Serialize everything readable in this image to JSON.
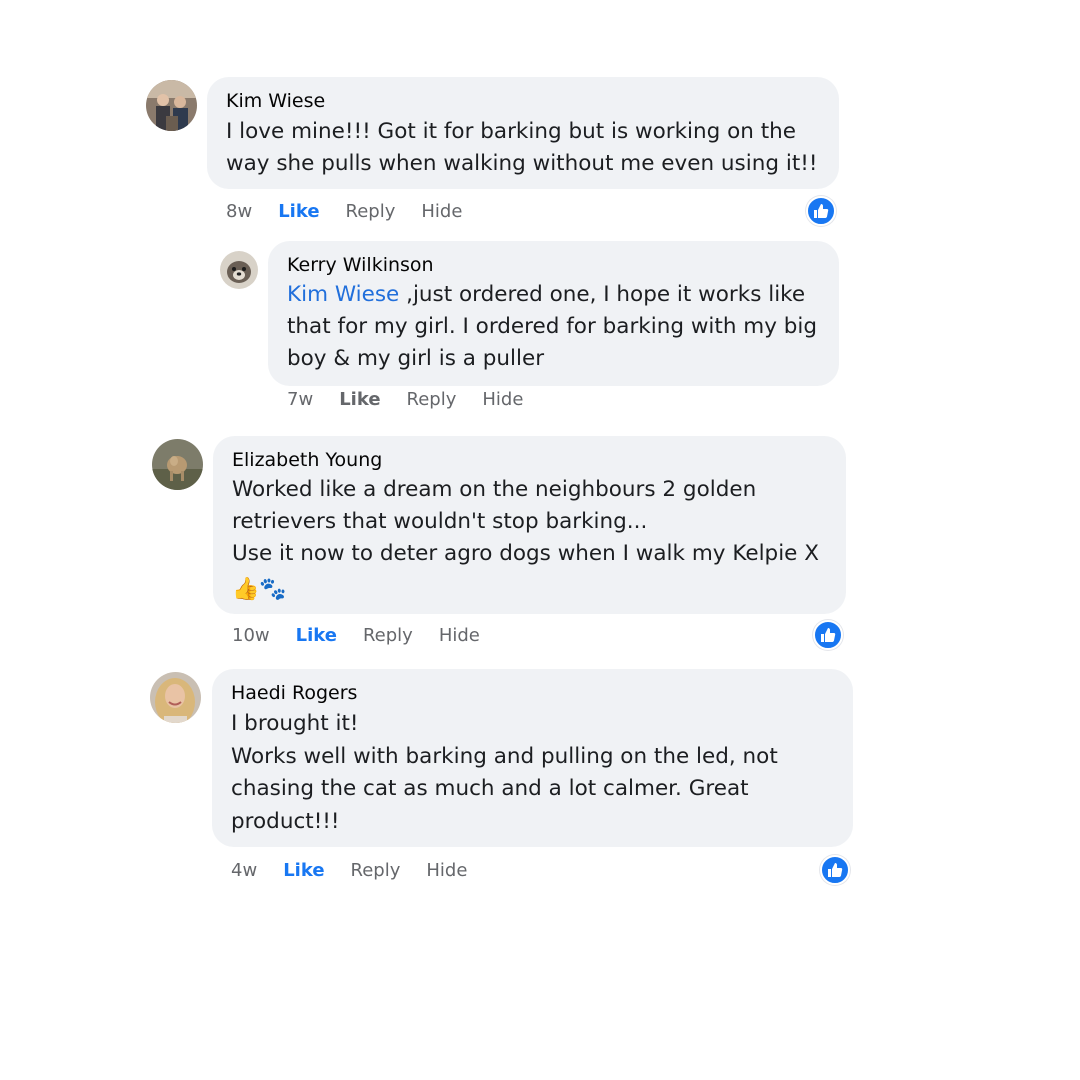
{
  "comments": [
    {
      "author": "Kim Wiese",
      "lines": [
        "I love mine!!! Got it for barking but is working on the",
        "way she pulls when walking without me even using it!!"
      ],
      "time": "8w",
      "like": "Like",
      "reply": "Reply",
      "hide": "Hide",
      "liked": true
    },
    {
      "author": "Kerry Wilkinson",
      "mention": "Kim Wiese",
      "lines": [
        " ,just ordered one, I hope it works like",
        "that for my girl. I ordered for barking with my big",
        "boy & my girl is a puller"
      ],
      "time": "7w",
      "like": "Like",
      "reply": "Reply",
      "hide": "Hide",
      "liked": false
    },
    {
      "author": "Elizabeth Young",
      "lines": [
        "Worked like a dream on the neighbours 2 golden",
        "retrievers that wouldn't stop barking...",
        "Use it now to deter agro dogs when I walk my Kelpie X"
      ],
      "emojis": "👍🐾",
      "time": "10w",
      "like": "Like",
      "reply": "Reply",
      "hide": "Hide",
      "liked": true
    },
    {
      "author": "Haedi Rogers",
      "lines": [
        "I brought it!",
        "Works well with barking and pulling on the led, not",
        "chasing the cat as much and a lot calmer. Great",
        "product!!!"
      ],
      "time": "4w",
      "like": "Like",
      "reply": "Reply",
      "hide": "Hide",
      "liked": true
    }
  ],
  "colors": {
    "bubble": "#f0f2f5",
    "like_active": "#1877f2",
    "mention": "#216fdb",
    "meta": "#65676b"
  },
  "icons": {
    "reaction": "like-thumbs-up-icon"
  }
}
